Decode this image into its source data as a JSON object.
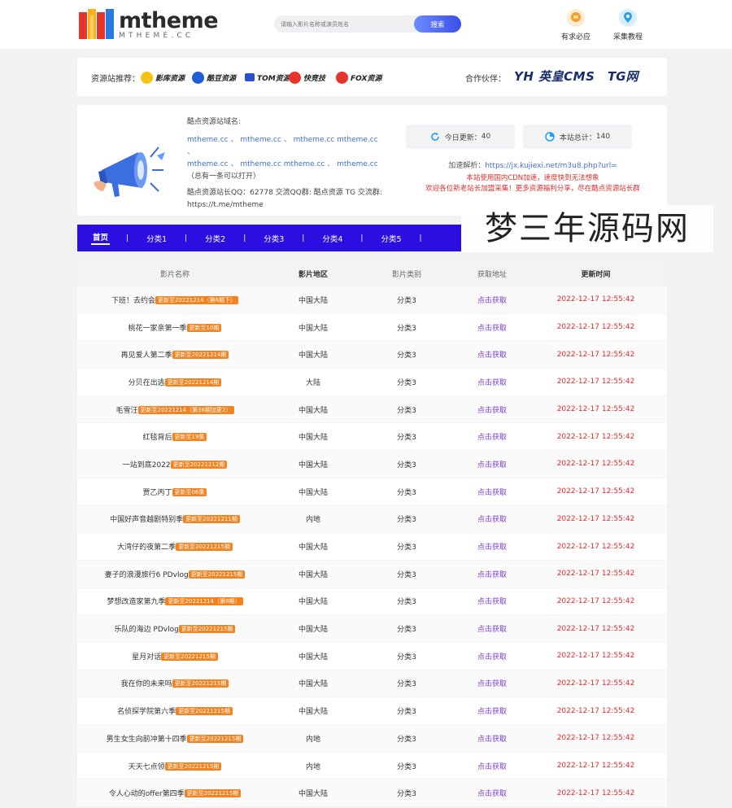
{
  "header": {
    "logo_text": "mtheme",
    "logo_sub": "MTHEME.CC",
    "search_placeholder": "请输入影片名称或演员姓名",
    "search_button": "搜索",
    "links": [
      {
        "label": "有求必应",
        "icon": "chat-bubble-icon",
        "color": "#f59d2a"
      },
      {
        "label": "采集教程",
        "icon": "location-pin-icon",
        "color": "#29a0f0"
      }
    ]
  },
  "recommend": {
    "title": "资源站推荐：",
    "brands": [
      "影库资源",
      "酷豆资源",
      "TOM资源",
      "快竞技",
      "FOX资源"
    ],
    "partner_title": "合作伙伴：",
    "partners": [
      "YH 英皇CMS",
      "TG网"
    ]
  },
  "info": {
    "domain_label": "酷点资源站域名:",
    "domains_line1": "mtheme.cc 、 mtheme.cc 、 mtheme.cc mtheme.cc 、",
    "domains_line2": "mtheme.cc 、 mtheme.cc mtheme.cc 、 mtheme.cc",
    "domains_note": "（总有一条可以打开）",
    "contact": "酷点资源站长QQ：62778 交流QQ群: 酷点资源 TG 交流群: https://t.me/mtheme",
    "today_label": "今日更新：",
    "today_value": "40",
    "total_label": "本站总计：",
    "total_value": "140",
    "parse_label": "加速解析：",
    "parse_url": "https://jx.kujiexi.net/m3u8.php?url=",
    "notice1": "本站使用国内CDN加速，速度快到无法想象",
    "notice2": "欢迎各位新老站长加盟采集！更多资源福利分享，尽在酷点资源站长群"
  },
  "nav": {
    "items": [
      "首页",
      "分类1",
      "分类2",
      "分类3",
      "分类4",
      "分类5"
    ]
  },
  "watermark": "梦三年源码网",
  "table": {
    "headers": [
      "影片名称",
      "影片地区",
      "影片类别",
      "获取地址",
      "更新时间"
    ],
    "rows": [
      {
        "name": "下班！去约会",
        "badge": "更新至20221214（第6期下）",
        "region": "中国大陆",
        "category": "分类3",
        "link": "点击获取",
        "time": "2022-12-17 12:55:42"
      },
      {
        "name": "桃花一家亲第一季",
        "badge": "更新至10期",
        "region": "中国大陆",
        "category": "分类3",
        "link": "点击获取",
        "time": "2022-12-17 12:55:42"
      },
      {
        "name": "再见爱人第二季",
        "badge": "更新至20221214期",
        "region": "中国大陆",
        "category": "分类3",
        "link": "点击获取",
        "time": "2022-12-17 12:55:42"
      },
      {
        "name": "分贝在出逃",
        "badge": "更新至20221214期",
        "region": "大陆",
        "category": "分类3",
        "link": "点击获取",
        "time": "2022-12-17 12:55:42"
      },
      {
        "name": "毛雪汪",
        "badge": "更新至20221214（第36期加更2）",
        "region": "中国大陆",
        "category": "分类3",
        "link": "点击获取",
        "time": "2022-12-17 12:55:42"
      },
      {
        "name": "红毯背后",
        "badge": "更新至19集",
        "region": "中国大陆",
        "category": "分类3",
        "link": "点击获取",
        "time": "2022-12-17 12:55:42"
      },
      {
        "name": "一站到底2022",
        "badge": "更新至20221212期",
        "region": "中国大陆",
        "category": "分类3",
        "link": "点击获取",
        "time": "2022-12-17 12:55:42"
      },
      {
        "name": "贾乙丙丁",
        "badge": "更新至06集",
        "region": "中国大陆",
        "category": "分类3",
        "link": "点击获取",
        "time": "2022-12-17 12:55:42"
      },
      {
        "name": "中国好声音越剧特别季",
        "badge": "更新至20221211期",
        "region": "内地",
        "category": "分类3",
        "link": "点击获取",
        "time": "2022-12-17 12:55:42"
      },
      {
        "name": "大湾仔的夜第二季",
        "badge": "更新至20221215期",
        "region": "中国大陆",
        "category": "分类3",
        "link": "点击获取",
        "time": "2022-12-17 12:55:42"
      },
      {
        "name": "妻子的浪漫旅行6 PDvlog",
        "badge": "更新至20221215期",
        "region": "中国大陆",
        "category": "分类3",
        "link": "点击获取",
        "time": "2022-12-17 12:55:42"
      },
      {
        "name": "梦想改造家第九季",
        "badge": "更新至20221214（第8期）",
        "region": "中国大陆",
        "category": "分类3",
        "link": "点击获取",
        "time": "2022-12-17 12:55:42"
      },
      {
        "name": "乐队的海边 PDvlog",
        "badge": "更新至20221215期",
        "region": "中国大陆",
        "category": "分类3",
        "link": "点击获取",
        "time": "2022-12-17 12:55:42"
      },
      {
        "name": "星月对话",
        "badge": "更新至20221215期",
        "region": "中国大陆",
        "category": "分类3",
        "link": "点击获取",
        "time": "2022-12-17 12:55:42"
      },
      {
        "name": "我在你的未来吗",
        "badge": "更新至20221215期",
        "region": "中国大陆",
        "category": "分类3",
        "link": "点击获取",
        "time": "2022-12-17 12:55:42"
      },
      {
        "name": "名侦探学院第六季",
        "badge": "更新至20221215期",
        "region": "中国大陆",
        "category": "分类3",
        "link": "点击获取",
        "time": "2022-12-17 12:55:42"
      },
      {
        "name": "男生女生向前冲第十四季",
        "badge": "更新至20221215期",
        "region": "内地",
        "category": "分类3",
        "link": "点击获取",
        "time": "2022-12-17 12:55:42"
      },
      {
        "name": "天天七点领",
        "badge": "更新至20221215期",
        "region": "内地",
        "category": "分类3",
        "link": "点击获取",
        "time": "2022-12-17 12:55:42"
      },
      {
        "name": "令人心动的offer第四季",
        "badge": "更新至20221215期",
        "region": "中国大陆",
        "category": "分类3",
        "link": "点击获取",
        "time": "2022-12-17 12:55:42"
      }
    ]
  }
}
